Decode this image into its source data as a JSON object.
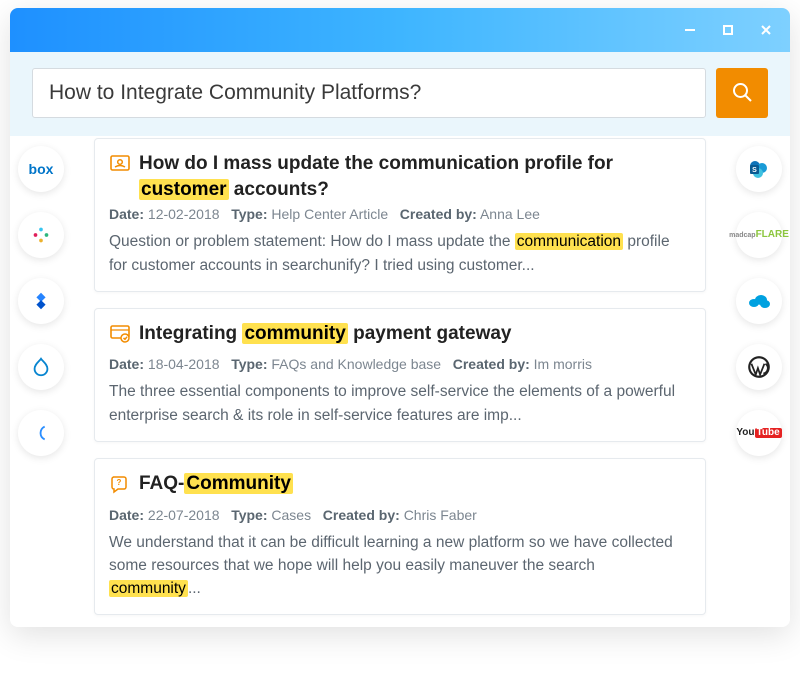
{
  "search": {
    "value": "How to Integrate Community Platforms?"
  },
  "sidebar_left": [
    {
      "id": "box",
      "label": "box"
    },
    {
      "id": "slack",
      "label": "slack"
    },
    {
      "id": "jira",
      "label": "jira"
    },
    {
      "id": "drupal",
      "label": "drupal"
    },
    {
      "id": "curve",
      "label": "curve"
    }
  ],
  "sidebar_right": [
    {
      "id": "sharepoint",
      "label": "sharepoint"
    },
    {
      "id": "flare",
      "label": "FLARE"
    },
    {
      "id": "salesforce",
      "label": "salesforce"
    },
    {
      "id": "wordpress",
      "label": "wordpress"
    },
    {
      "id": "youtube",
      "label": "YouTube"
    }
  ],
  "meta_labels": {
    "date": "Date:",
    "type": "Type:",
    "created_by": "Created by:"
  },
  "results": [
    {
      "title_pre": "How do I mass update the communication profile for ",
      "title_hl": "customer",
      "title_post": " accounts?",
      "date": "12-02-2018",
      "type": "Help Center Article",
      "author": "Anna Lee",
      "snippet_pre": "Question or problem statement: How do I mass update the ",
      "snippet_hl": "communication",
      "snippet_post": " profile for customer accounts in searchunify? I tried using customer..."
    },
    {
      "title_pre": "Integrating ",
      "title_hl": "community",
      "title_post": " payment gateway",
      "date": "18-04-2018",
      "type": "FAQs and Knowledge base",
      "author": "Im morris",
      "snippet_pre": "The three essential components to improve self-service the elements of a powerful enterprise search & its role in self-service features are imp...",
      "snippet_hl": "",
      "snippet_post": ""
    },
    {
      "title_pre": "FAQ-",
      "title_hl": "Community",
      "title_post": "",
      "date": "22-07-2018",
      "type": "Cases",
      "author": "Chris Faber",
      "snippet_pre": "We understand that it can be difficult learning a new platform so we have collected some resources that we hope will help you easily maneuver the search ",
      "snippet_hl": "community",
      "snippet_post": "..."
    }
  ]
}
